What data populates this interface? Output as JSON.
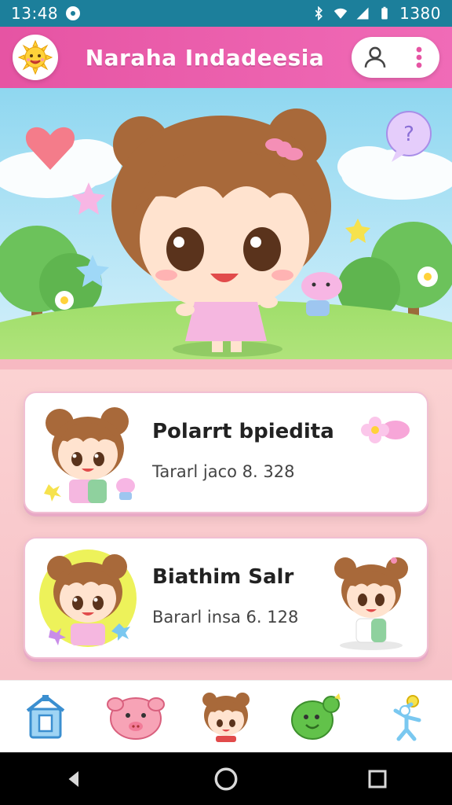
{
  "status_bar": {
    "time": "13:48",
    "right_time": "1380"
  },
  "app_bar": {
    "title": "Naraha Indadeesia",
    "logo_icon": "sun-icon",
    "profile_icon": "user-icon",
    "menu_icon": "more-vert-icon"
  },
  "colors": {
    "accent": "#e654a3",
    "status": "#1c7f9b",
    "card_border": "#f1bfd3"
  },
  "cards": [
    {
      "title": "Polarrt bpiedita",
      "subtitle": "Tararl jaco 8. 328",
      "avatar_icon": "girl-avatar-icon",
      "badge_icon": "flower-badge-icon"
    },
    {
      "title": "Biathim Salr",
      "subtitle": "Bararl insa 6. 128",
      "avatar_icon": "girl-avatar-icon",
      "badge_icon": "girl-mini-icon"
    }
  ],
  "bottom_nav": [
    {
      "name": "home",
      "icon": "house-icon"
    },
    {
      "name": "pig",
      "icon": "pig-icon"
    },
    {
      "name": "girl",
      "icon": "girl-icon"
    },
    {
      "name": "dino",
      "icon": "dino-icon"
    },
    {
      "name": "figure",
      "icon": "figure-icon"
    }
  ],
  "system_nav": {
    "back": "back-icon",
    "home": "home-circle-icon",
    "recent": "recent-square-icon"
  }
}
